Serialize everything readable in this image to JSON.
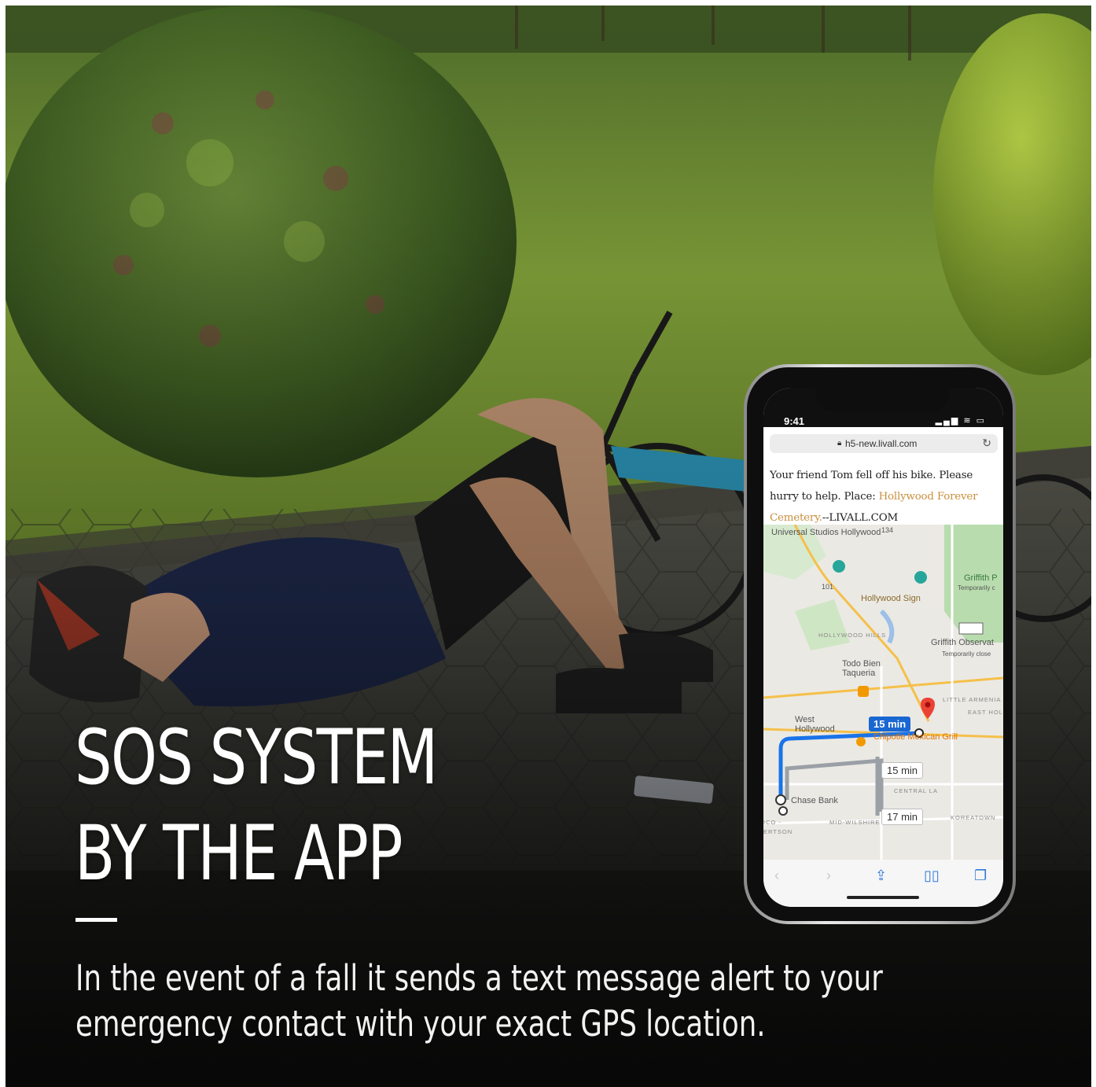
{
  "headline": {
    "line1": "SOS SYSTEM",
    "line2": "BY THE APP"
  },
  "caption": "In the event of a fall it sends a text message alert to your emergency contact with your exact GPS location.",
  "phone": {
    "status_time": "9:41",
    "url": "h5-new.livall.com",
    "message": {
      "text_before": "Your friend Tom fell off his bike. Please hurry to help. Place: ",
      "place": "Hollywood Forever Cemetery.",
      "text_after": "--LIVALL.COM"
    },
    "map": {
      "labels": {
        "universal": "Universal Studios Hollywood",
        "hollywood_sign": "Hollywood Sign",
        "griffith_park": "Griffith P",
        "griffith_park_sub": "Temporarily c",
        "hollywood_hills": "HOLLYWOOD HILLS",
        "griffith_obs": "Griffith Observat",
        "griffith_obs_sub": "Temporarily close",
        "todo_bien": "Todo Bien Taqueria",
        "little_armenia": "LITTLE ARMENIA",
        "east_hollywood": "EAST HOLLYWO",
        "west_hollywood": "West Hollywood",
        "chipotle": "Chipotle Mexican Grill",
        "central": "CENTRAL LA",
        "chase": "Chase Bank",
        "mid_wilshire": "MID-WILSHIRE",
        "koreatown": "KOREATOWN",
        "ertson": "ERTSON",
        "ico": "ICO -",
        "route_134": "134",
        "route_101": "101"
      },
      "routes": {
        "primary_time": "15 min",
        "alt1_time": "15 min",
        "alt2_time": "17 min"
      }
    }
  }
}
